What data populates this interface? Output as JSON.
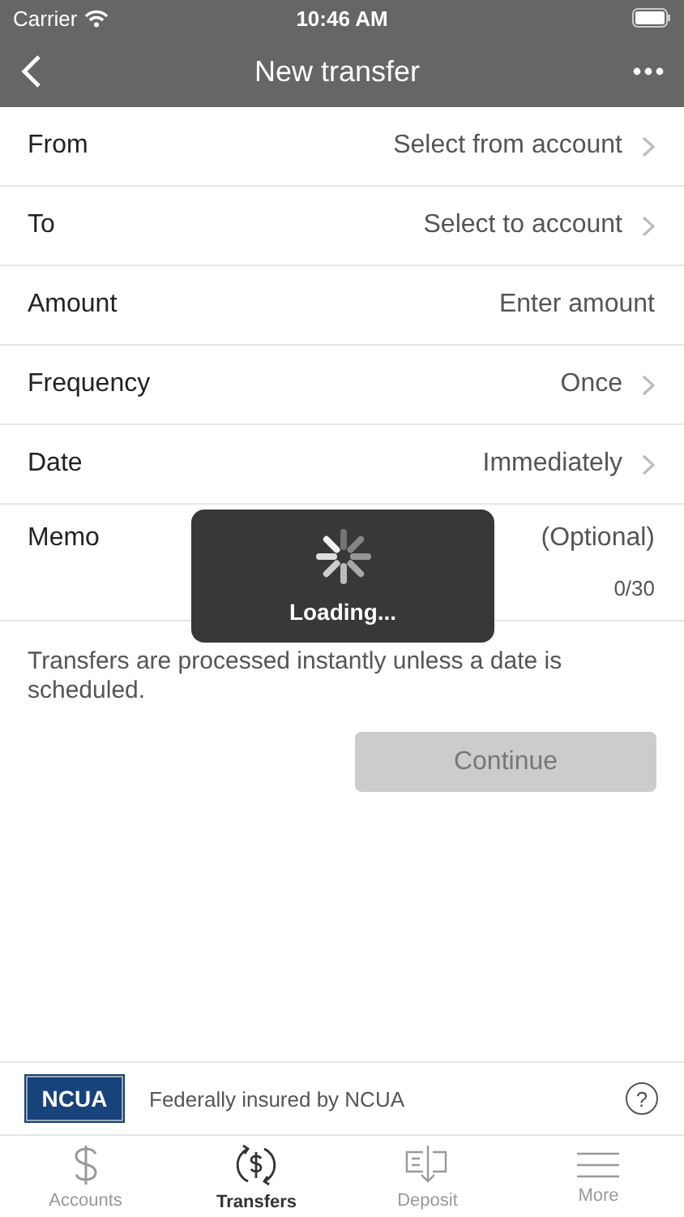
{
  "status_bar": {
    "carrier": "Carrier",
    "time": "10:46 AM"
  },
  "nav": {
    "title": "New transfer"
  },
  "fields": [
    {
      "kind": "select",
      "label": "From",
      "value": "Select from account"
    },
    {
      "kind": "select",
      "label": "To",
      "value": "Select to account"
    },
    {
      "kind": "input",
      "label": "Amount",
      "placeholder": "Enter amount"
    },
    {
      "kind": "select",
      "label": "Frequency",
      "value": "Once"
    },
    {
      "kind": "select",
      "label": "Date",
      "value": "Immediately"
    },
    {
      "kind": "memo",
      "label": "Memo",
      "placeholder": "(Optional)",
      "counter": "0/30"
    }
  ],
  "note": "Transfers are processed instantly unless a date is scheduled.",
  "continue_button": {
    "label": "Continue",
    "disabled": true
  },
  "loading": {
    "label": "Loading..."
  },
  "footer": {
    "badge": "NCUA",
    "text": "Federally insured by NCUA",
    "help": "?"
  },
  "tabs": [
    {
      "kind": "accounts",
      "label": "Accounts",
      "selected": false
    },
    {
      "kind": "transfers",
      "label": "Transfers",
      "selected": true
    },
    {
      "kind": "deposit",
      "label": "Deposit",
      "selected": false
    },
    {
      "kind": "more",
      "label": "More",
      "selected": false
    }
  ]
}
